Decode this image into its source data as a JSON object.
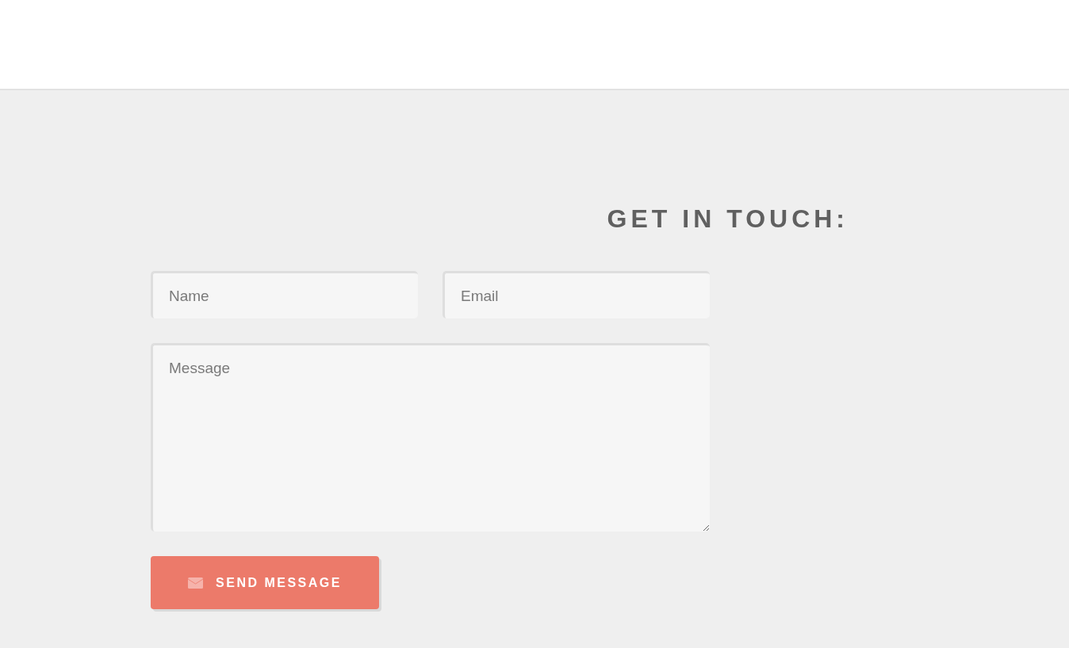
{
  "heading": "GET IN TOUCH:",
  "form": {
    "name_field": {
      "placeholder": "Name"
    },
    "email_field": {
      "placeholder": "Email"
    },
    "message_field": {
      "placeholder": "Message"
    },
    "submit": {
      "label": "SEND MESSAGE"
    }
  }
}
